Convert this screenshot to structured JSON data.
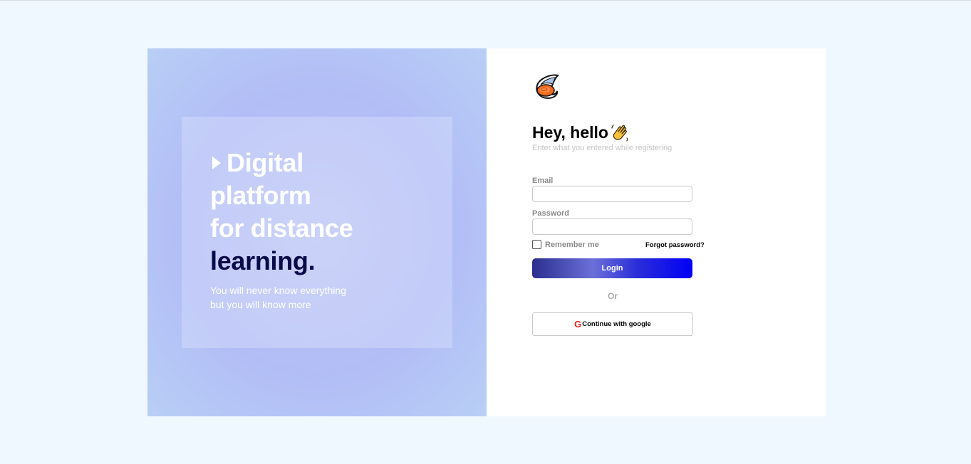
{
  "hero": {
    "headline_line1": "Digital",
    "headline_line2": "platform",
    "headline_line3": "for distance",
    "headline_line4": "learning.",
    "tagline_line1": "You will never know everything",
    "tagline_line2": "but you will know more",
    "icon": "play-arrow-icon"
  },
  "login": {
    "logo_icon": "brand-logo-icon",
    "greeting": "Hey, hello",
    "greeting_icon": "waving-hand-icon",
    "subtitle": "Enter what you entered while registering",
    "email_label": "Email",
    "email_value": "",
    "password_label": "Password",
    "password_value": "",
    "remember_label": "Remember me",
    "remember_checked": false,
    "forgot_label": "Forgot password?",
    "login_label": "Login",
    "or_label": "Or",
    "google_icon": "google-g-icon",
    "google_label": "Continue with google"
  },
  "colors": {
    "page_background": "#f0f8ff",
    "hero_background": "#b4c0f6",
    "headline_accent": "#0a0a4a",
    "button_gradient_end": "#0000f5",
    "google_red": "#e8231a"
  }
}
